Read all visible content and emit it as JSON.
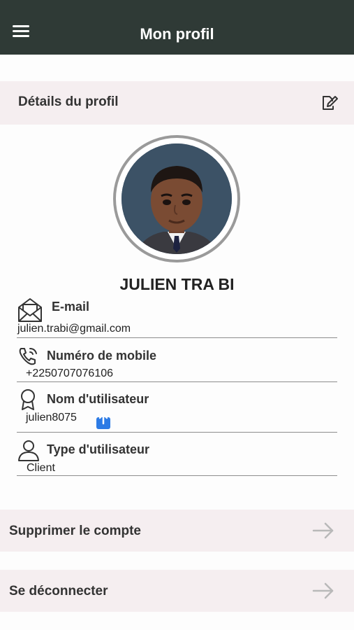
{
  "app_bar": {
    "title": "Mon profil"
  },
  "profile_section": {
    "title": "Détails du profil"
  },
  "user": {
    "full_name": "JULIEN TRA BI"
  },
  "fields": {
    "email": {
      "label": "E-mail",
      "value": "julien.trabi@gmail.com"
    },
    "mobile": {
      "label": "Numéro de mobile",
      "value": "+2250707076106"
    },
    "username": {
      "label": "Nom d'utilisateur",
      "value": "julien8075"
    },
    "user_type": {
      "label": "Type d'utilisateur",
      "value": "Client"
    }
  },
  "actions": {
    "delete_account": {
      "label": "Supprimer le compte"
    },
    "logout": {
      "label": "Se déconnecter"
    }
  },
  "icons": {
    "menu": "menu-icon",
    "edit": "edit-icon",
    "email": "envelope-icon",
    "phone": "phone-icon",
    "username": "badge-icon",
    "user_type": "user-icon",
    "share": "share-icon",
    "arrow": "arrow-right-icon"
  },
  "colors": {
    "app_bar": "#2f3a36",
    "section_background": "#f5eef0",
    "share_accent": "#2d7be5",
    "arrow": "#b9b9b9"
  }
}
